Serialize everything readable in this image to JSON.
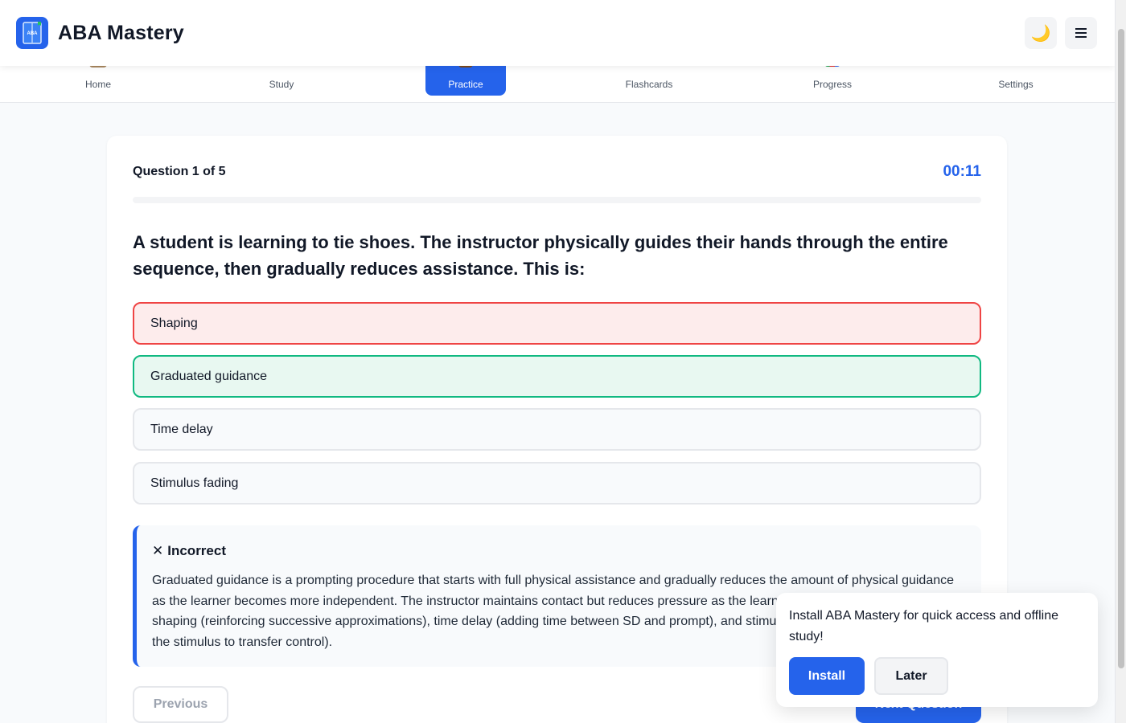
{
  "app": {
    "title": "ABA Mastery",
    "logo_icon": "book-icon",
    "theme_toggle_icon": "moon-icon",
    "menu_icon": "hamburger-menu-icon",
    "accent": "#2563eb"
  },
  "nav": {
    "items": [
      {
        "label": "Home",
        "icon": "home-icon",
        "active": false
      },
      {
        "label": "Study",
        "icon": "study-icon",
        "active": false
      },
      {
        "label": "Practice",
        "icon": "practice-icon",
        "active": true
      },
      {
        "label": "Flashcards",
        "icon": "flashcards-icon",
        "active": false
      },
      {
        "label": "Progress",
        "icon": "chart-icon",
        "active": false
      },
      {
        "label": "Settings",
        "icon": "gear-icon",
        "active": false
      }
    ]
  },
  "quiz": {
    "counter": "Question 1 of 5",
    "timer": "00:11",
    "progress": 0,
    "question": "A student is learning to tie shoes. The instructor physically guides their hands through the entire sequence, then gradually reduces assistance. This is:",
    "options": [
      {
        "label": "Shaping",
        "state": "incorrect-selected"
      },
      {
        "label": "Graduated guidance",
        "state": "correct"
      },
      {
        "label": "Time delay",
        "state": "neutral"
      },
      {
        "label": "Stimulus fading",
        "state": "neutral"
      }
    ],
    "feedback": {
      "icon": "x-icon",
      "symbol": "✕",
      "title": "Incorrect",
      "text": "Graduated guidance is a prompting procedure that starts with full physical assistance and gradually reduces the amount of physical guidance as the learner becomes more independent. The instructor maintains contact but reduces pressure as the learner succeeds. It differs from shaping (reinforcing successive approximations), time delay (adding time between SD and prompt), and stimulus fading (gradually changing the stimulus to transfer control)."
    },
    "previous_label": "Previous",
    "next_label": "Next Question"
  },
  "install_prompt": {
    "message": "Install ABA Mastery for quick access and offline study!",
    "install_label": "Install",
    "later_label": "Later"
  }
}
